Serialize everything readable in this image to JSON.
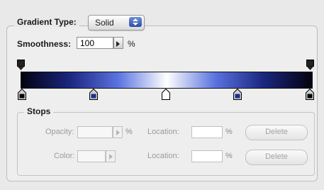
{
  "gradient": {
    "type_label": "Gradient Type:",
    "type_value": "Solid",
    "smoothness_label": "Smoothness:",
    "smoothness_value": "100",
    "percent": "%",
    "bar_colors": [
      "#03030f",
      "#1b2680",
      "#5a73e0",
      "#ffffff",
      "#5a73e0",
      "#1b2680",
      "#03030f"
    ]
  },
  "stops": {
    "section_label": "Stops",
    "opacity_label": "Opacity:",
    "opacity_value": "",
    "opacity_unit": "%",
    "color_label": "Color:",
    "location_label": "Location:",
    "location_value_1": "",
    "location_unit": "%",
    "location_value_2": "",
    "delete_label": "Delete"
  }
}
